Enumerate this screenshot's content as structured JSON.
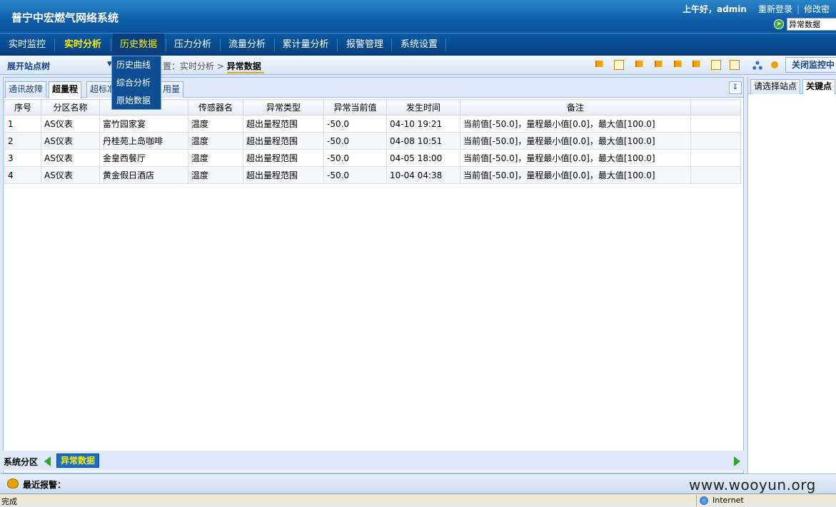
{
  "header": {
    "title": "普宁中宏燃气网络系统",
    "greeting": "上午好，admin",
    "links": [
      "重新登录",
      "修改密"
    ],
    "search_value": "异常数据"
  },
  "nav": {
    "items": [
      "实时监控",
      "实时分析",
      "历史数据",
      "压力分析",
      "流量分析",
      "累计量分析",
      "报警管理",
      "系统设置"
    ],
    "active_index": 1,
    "hover_index": 2
  },
  "dropdown": {
    "items": [
      "历史曲线",
      "综合分析",
      "原始数据"
    ]
  },
  "toolbar": {
    "tree_label": "展开站点树",
    "breadcrumb_prefix": "置：实时分析 >",
    "breadcrumb_current": "异常数据",
    "close_button": "关闭监控中"
  },
  "tabs": [
    "通讯故障",
    "超量程",
    "超标准",
    "用量"
  ],
  "active_tab": 1,
  "table": {
    "columns": [
      "序号",
      "分区名称",
      "",
      "传感器名",
      "异常类型",
      "异常当前值",
      "发生时间",
      "备注"
    ],
    "rows": [
      [
        "1",
        "AS仪表",
        "富竹园家宴",
        "温度",
        "超出量程范围",
        "-50.0",
        "04-10 19:21",
        "当前值[-50.0]，量程最小值[0.0]，最大值[100.0]"
      ],
      [
        "2",
        "AS仪表",
        "丹桂苑上岛咖啡",
        "温度",
        "超出量程范围",
        "-50.0",
        "04-08 10:51",
        "当前值[-50.0]，量程最小值[0.0]，最大值[100.0]"
      ],
      [
        "3",
        "AS仪表",
        "金皇西餐厅",
        "温度",
        "超出量程范围",
        "-50.0",
        "04-05 18:00",
        "当前值[-50.0]，量程最小值[0.0]，最大值[100.0]"
      ],
      [
        "4",
        "AS仪表",
        "黄金假日酒店",
        "温度",
        "超出量程范围",
        "-50.0",
        "10-04 04:38",
        "当前值[-50.0]，量程最小值[0.0]，最大值[100.0]"
      ]
    ]
  },
  "bottom": {
    "label": "系统分区",
    "tab": "异常数据"
  },
  "right_panel": {
    "tabs": [
      "请选择站点",
      "关键点"
    ]
  },
  "alarm": {
    "label": "最近报警："
  },
  "watermark": "www.wooyun.org",
  "statusbar": {
    "text": "完成",
    "zone": "Internet"
  },
  "colors": {
    "accent": "#ffee00",
    "header_blue": "#0f5ea8",
    "nav_blue": "#063f7e"
  }
}
